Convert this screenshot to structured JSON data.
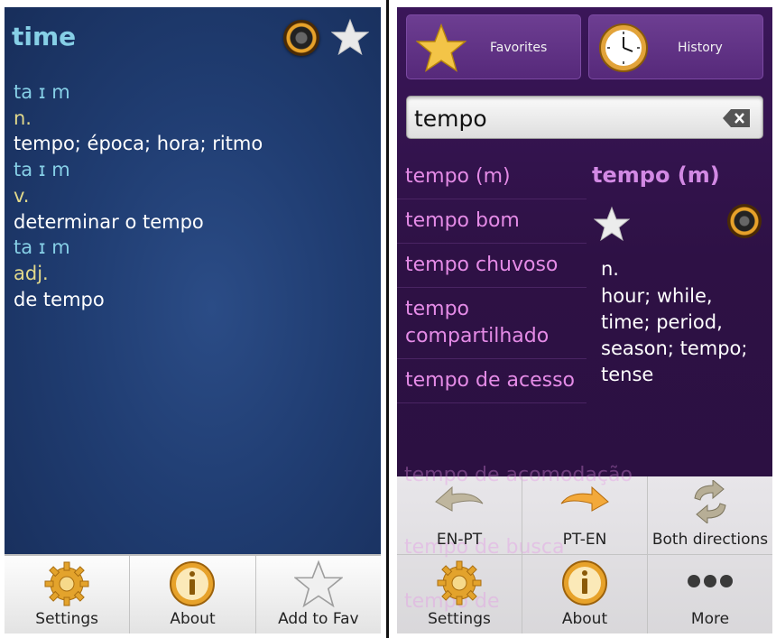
{
  "left": {
    "word": "time",
    "entries": [
      {
        "pron": "ta ɪ m",
        "pos": "n.",
        "translation": "tempo; época; hora; ritmo"
      },
      {
        "pron": "ta ɪ m",
        "pos": "v.",
        "translation": "determinar o tempo"
      },
      {
        "pron": "ta ɪ m",
        "pos": "adj.",
        "translation": "de tempo"
      }
    ],
    "bottom_bar": {
      "settings": "Settings",
      "about": "About",
      "add_to_fav": "Add to Fav"
    }
  },
  "right": {
    "tabs": {
      "favorites": "Favorites",
      "history": "History"
    },
    "search": {
      "value": "tempo"
    },
    "results": [
      "tempo (m)",
      "tempo bom",
      "tempo chuvoso",
      "tempo compartilhado",
      "tempo de acesso"
    ],
    "ghost_results": [
      "tempo de acomodação",
      "tempo de busca",
      "tempo de"
    ],
    "detail": {
      "title": "tempo (m)",
      "pos": "n.",
      "definition": "hour; while, time; period, season; tempo; tense"
    },
    "menu": {
      "en_pt": "EN-PT",
      "pt_en": "PT-EN",
      "both": "Both directions",
      "settings": "Settings",
      "about": "About",
      "more": "More"
    }
  },
  "colors": {
    "left_bg": "#203d72",
    "right_bg": "#2e1145",
    "pron": "#86cfe6",
    "pos": "#e2d98b",
    "result_text": "#e48be6",
    "accent_gold": "#e7a22a"
  },
  "icons": [
    "star-icon",
    "audio-icon",
    "gear-icon",
    "info-icon",
    "clock-icon",
    "clear-icon",
    "arrow-left-icon",
    "arrow-right-icon",
    "swap-icon",
    "more-icon"
  ]
}
